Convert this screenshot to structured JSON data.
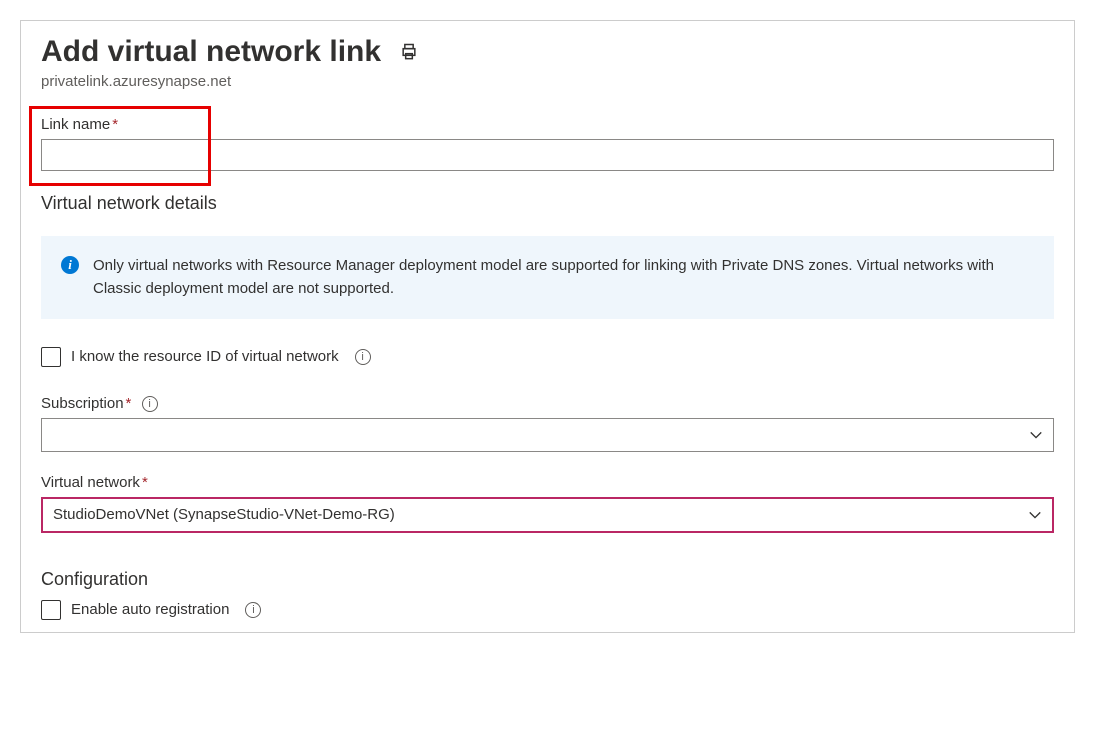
{
  "header": {
    "title": "Add virtual network link",
    "subtitle": "privatelink.azuresynapse.net"
  },
  "linkName": {
    "label": "Link name",
    "value": ""
  },
  "vnetDetails": {
    "heading": "Virtual network details",
    "infoBanner": "Only virtual networks with Resource Manager deployment model are supported for linking with Private DNS zones. Virtual networks with Classic deployment model are not supported.",
    "knowResourceId": {
      "label": "I know the resource ID of virtual network",
      "checked": false
    },
    "subscription": {
      "label": "Subscription",
      "value": ""
    },
    "virtualNetwork": {
      "label": "Virtual network",
      "value": "StudioDemoVNet (SynapseStudio-VNet-Demo-RG)"
    }
  },
  "configuration": {
    "heading": "Configuration",
    "autoReg": {
      "label": "Enable auto registration",
      "checked": false
    }
  }
}
